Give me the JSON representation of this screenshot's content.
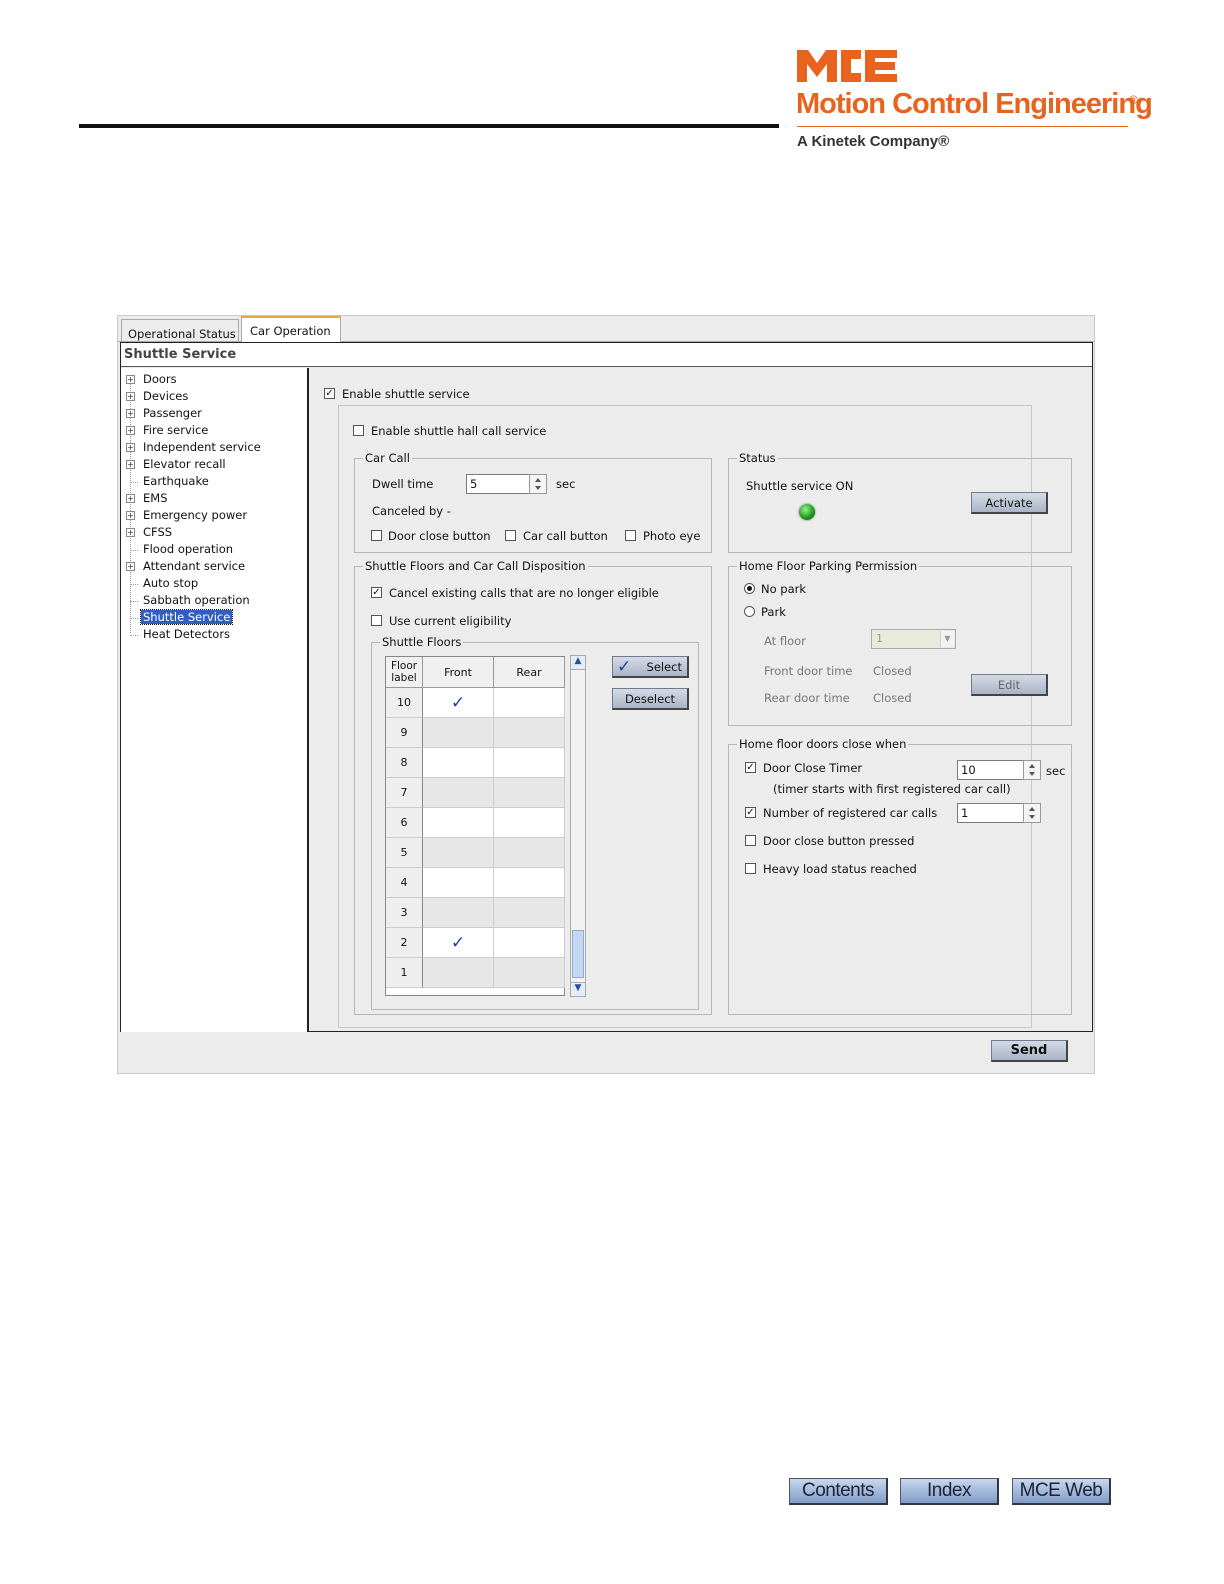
{
  "brand": {
    "logo_text": "MCE",
    "name": "Motion Control Engineering",
    "registered": "®",
    "tagline": "A Kinetek Company®",
    "color": "#e8641e"
  },
  "tabs": [
    {
      "label": "Operational Status"
    },
    {
      "label": "Car Operation",
      "active": true
    }
  ],
  "panel_title": "Shuttle Service",
  "tree": [
    {
      "label": "Doors",
      "expandable": true
    },
    {
      "label": "Devices",
      "expandable": true
    },
    {
      "label": "Passenger",
      "expandable": true
    },
    {
      "label": "Fire service",
      "expandable": true
    },
    {
      "label": "Independent service",
      "expandable": true
    },
    {
      "label": "Elevator recall",
      "expandable": true
    },
    {
      "label": "Earthquake",
      "expandable": false
    },
    {
      "label": "EMS",
      "expandable": true
    },
    {
      "label": "Emergency power",
      "expandable": true
    },
    {
      "label": "CFSS",
      "expandable": true
    },
    {
      "label": "Flood operation",
      "expandable": false
    },
    {
      "label": "Attendant service",
      "expandable": true
    },
    {
      "label": "Auto stop",
      "expandable": false
    },
    {
      "label": "Sabbath operation",
      "expandable": false
    },
    {
      "label": "Shuttle Service",
      "expandable": false,
      "selected": true
    },
    {
      "label": "Heat Detectors",
      "expandable": false
    }
  ],
  "enable_shuttle": {
    "label": "Enable shuttle service",
    "checked": true
  },
  "enable_hall": {
    "label": "Enable shuttle hall call service",
    "checked": false
  },
  "car_call": {
    "title": "Car Call",
    "dwell_label": "Dwell time",
    "dwell_value": "5",
    "dwell_unit": "sec",
    "canceled_by": "Canceled by -",
    "options": [
      {
        "label": "Door close button",
        "checked": false
      },
      {
        "label": "Car call button",
        "checked": false
      },
      {
        "label": "Photo eye",
        "checked": false
      }
    ]
  },
  "status": {
    "title": "Status",
    "text": "Shuttle service ON",
    "activate_label": "Activate",
    "led_color": "#1e9e1e"
  },
  "disposition": {
    "title": "Shuttle Floors and Car Call Disposition",
    "cancel_existing": {
      "label": "Cancel existing calls that are no longer eligible",
      "checked": true
    },
    "use_current": {
      "label": "Use current eligibility",
      "checked": false
    },
    "floors_title": "Shuttle Floors",
    "columns": {
      "floor": "Floor label",
      "front": "Front",
      "rear": "Rear"
    },
    "rows": [
      {
        "floor": "10",
        "front": true,
        "rear": false
      },
      {
        "floor": "9",
        "front": false,
        "rear": false
      },
      {
        "floor": "8",
        "front": false,
        "rear": false
      },
      {
        "floor": "7",
        "front": false,
        "rear": false
      },
      {
        "floor": "6",
        "front": false,
        "rear": false
      },
      {
        "floor": "5",
        "front": false,
        "rear": false
      },
      {
        "floor": "4",
        "front": false,
        "rear": false
      },
      {
        "floor": "3",
        "front": false,
        "rear": false
      },
      {
        "floor": "2",
        "front": true,
        "rear": false
      },
      {
        "floor": "1",
        "front": false,
        "rear": false
      }
    ],
    "select_label": "Select",
    "deselect_label": "Deselect"
  },
  "parking": {
    "title": "Home Floor Parking Permission",
    "no_park": {
      "label": "No park",
      "selected": true
    },
    "park": {
      "label": "Park",
      "selected": false
    },
    "at_floor_label": "At floor",
    "at_floor_value": "1",
    "front_door_label": "Front door time",
    "front_door_value": "Closed",
    "rear_door_label": "Rear door time",
    "rear_door_value": "Closed",
    "edit_label": "Edit"
  },
  "doors_close": {
    "title": "Home floor doors close when",
    "timer": {
      "label": "Door Close Timer",
      "checked": true,
      "value": "10",
      "unit": "sec"
    },
    "timer_note": "(timer starts with first registered car call)",
    "registered": {
      "label": "Number of registered car calls",
      "checked": true,
      "value": "1"
    },
    "door_close_button": {
      "label": "Door close button pressed",
      "checked": false
    },
    "heavy_load": {
      "label": "Heavy load status reached",
      "checked": false
    }
  },
  "send_label": "Send",
  "nav": [
    {
      "label": "Contents"
    },
    {
      "label": "Index"
    },
    {
      "label": "MCE Web"
    }
  ]
}
